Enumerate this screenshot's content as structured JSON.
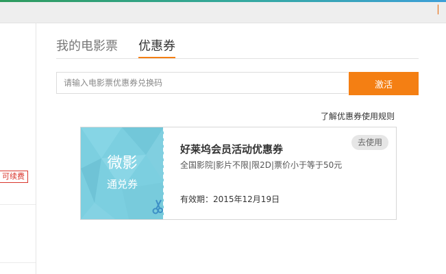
{
  "tabs": [
    {
      "label": "我的电影票"
    },
    {
      "label": "优惠券"
    }
  ],
  "redeem": {
    "placeholder": "请输入电影票优惠券兑换码",
    "button_label": "激活"
  },
  "rules_link": "了解优惠券使用规则",
  "coupon": {
    "brand": "微影",
    "kind": "通兑券",
    "title": "好莱坞会员活动优惠券",
    "description": "全国影院|影片不限|限2D|票价小于等于50元",
    "expiry": "有效期：2015年12月19日",
    "use_label": "去使用"
  },
  "sidebar": {
    "renew_badge": "可续费"
  },
  "colors": {
    "accent": "#f47f13",
    "coupon_bg": "#7ccfe0",
    "renew": "#d9342b"
  }
}
